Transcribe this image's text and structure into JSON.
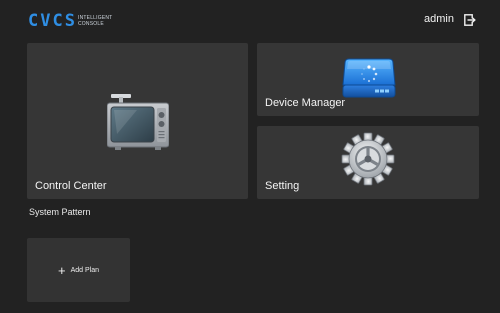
{
  "header": {
    "logo": {
      "letters": [
        "C",
        "V",
        "C",
        "S"
      ],
      "subtitle_line1": "INTELLIGENT",
      "subtitle_line2": "CONSOLE"
    },
    "user": {
      "name": "admin",
      "logout_icon": "logout-icon"
    }
  },
  "main": {
    "cards": {
      "control_center": {
        "label": "Control Center",
        "icon": "tv-icon"
      },
      "device_manager": {
        "label": "Device Manager",
        "icon": "hard-drive-icon"
      },
      "setting": {
        "label": "Setting",
        "icon": "gear-icon"
      }
    },
    "system_pattern": {
      "title": "System Pattern",
      "add_plan": {
        "label": "Add Plan",
        "icon": "plus-icon"
      }
    }
  },
  "colors": {
    "background": "#222222",
    "card": "#363636",
    "brand_blue": "#2f8ee3"
  }
}
